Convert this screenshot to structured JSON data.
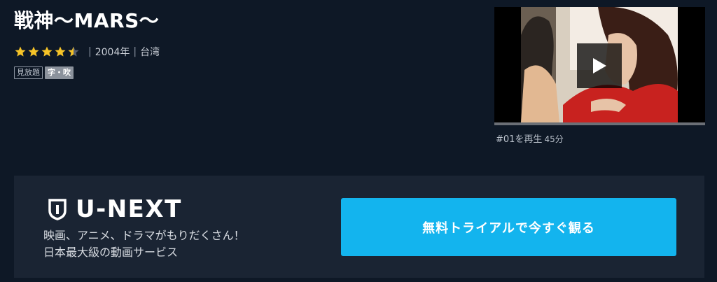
{
  "title": "戦神～MARS～",
  "rating": {
    "value": 4.5,
    "max": 5,
    "star_color": "#f6c428"
  },
  "meta": {
    "year": "2004年",
    "country": "台湾",
    "separator": "|"
  },
  "badges": {
    "watch_free": "見放題",
    "subtitle_dub": "字・吹"
  },
  "video": {
    "play_label": "#01を再生",
    "duration": "45分",
    "icon": "play-icon"
  },
  "banner": {
    "brand": "U-NEXT",
    "brand_icon": "shield-icon",
    "tagline_line1": "映画、アニメ、ドラマがもりだくさん！",
    "tagline_line2": "日本最大級の動画サービス",
    "cta_label": "無料トライアルで今すぐ観る",
    "cta_color": "#13b4ee"
  }
}
